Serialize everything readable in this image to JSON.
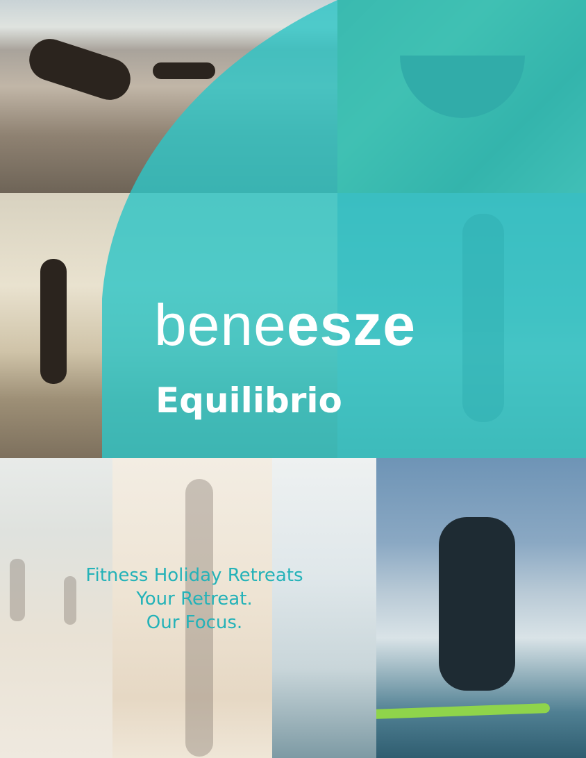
{
  "brand": {
    "logo_text_light": "bene",
    "logo_text_bold": "esze",
    "subtitle": "Equilibrio"
  },
  "tagline": {
    "line1": "Fitness Holiday Retreats",
    "line2": "Your Retreat.",
    "line3": "Our Focus."
  },
  "colors": {
    "teal": "#2ec4c6",
    "tagline": "#24b2b8",
    "text_on_teal": "#ffffff"
  }
}
